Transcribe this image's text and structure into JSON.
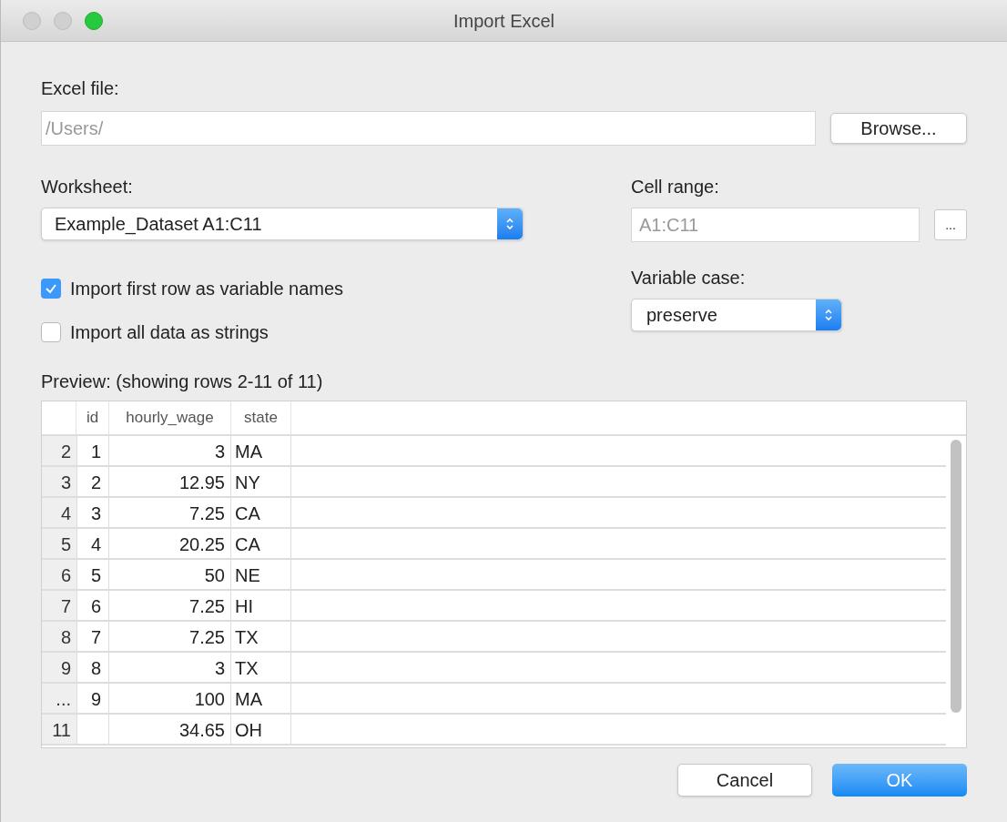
{
  "window": {
    "title": "Import Excel"
  },
  "excel_file": {
    "label": "Excel file:",
    "value": "/Users/",
    "browse_button": "Browse..."
  },
  "worksheet": {
    "label": "Worksheet:",
    "value": "Example_Dataset A1:C11"
  },
  "cell_range": {
    "label": "Cell range:",
    "value": "A1:C11",
    "button": "..."
  },
  "options": [
    {
      "label": "Import first row as variable names",
      "checked": true
    },
    {
      "label": "Import all data as strings",
      "checked": false
    }
  ],
  "variable_case": {
    "label": "Variable case:",
    "value": "preserve"
  },
  "preview": {
    "label": "Preview: (showing rows 2-11 of 11)",
    "columns": [
      "",
      "id",
      "hourly_wage",
      "state"
    ],
    "rows": [
      [
        "2",
        "1",
        "3",
        "MA"
      ],
      [
        "3",
        "2",
        "12.95",
        "NY"
      ],
      [
        "4",
        "3",
        "7.25",
        "CA"
      ],
      [
        "5",
        "4",
        "20.25",
        "CA"
      ],
      [
        "6",
        "5",
        "50",
        "NE"
      ],
      [
        "7",
        "6",
        "7.25",
        "HI"
      ],
      [
        "8",
        "7",
        "7.25",
        "TX"
      ],
      [
        "9",
        "8",
        "3",
        "TX"
      ],
      [
        "...",
        "9",
        "100",
        "MA"
      ],
      [
        "11",
        "",
        "34.65",
        "OH"
      ]
    ]
  },
  "buttons": {
    "cancel": "Cancel",
    "ok": "OK"
  }
}
